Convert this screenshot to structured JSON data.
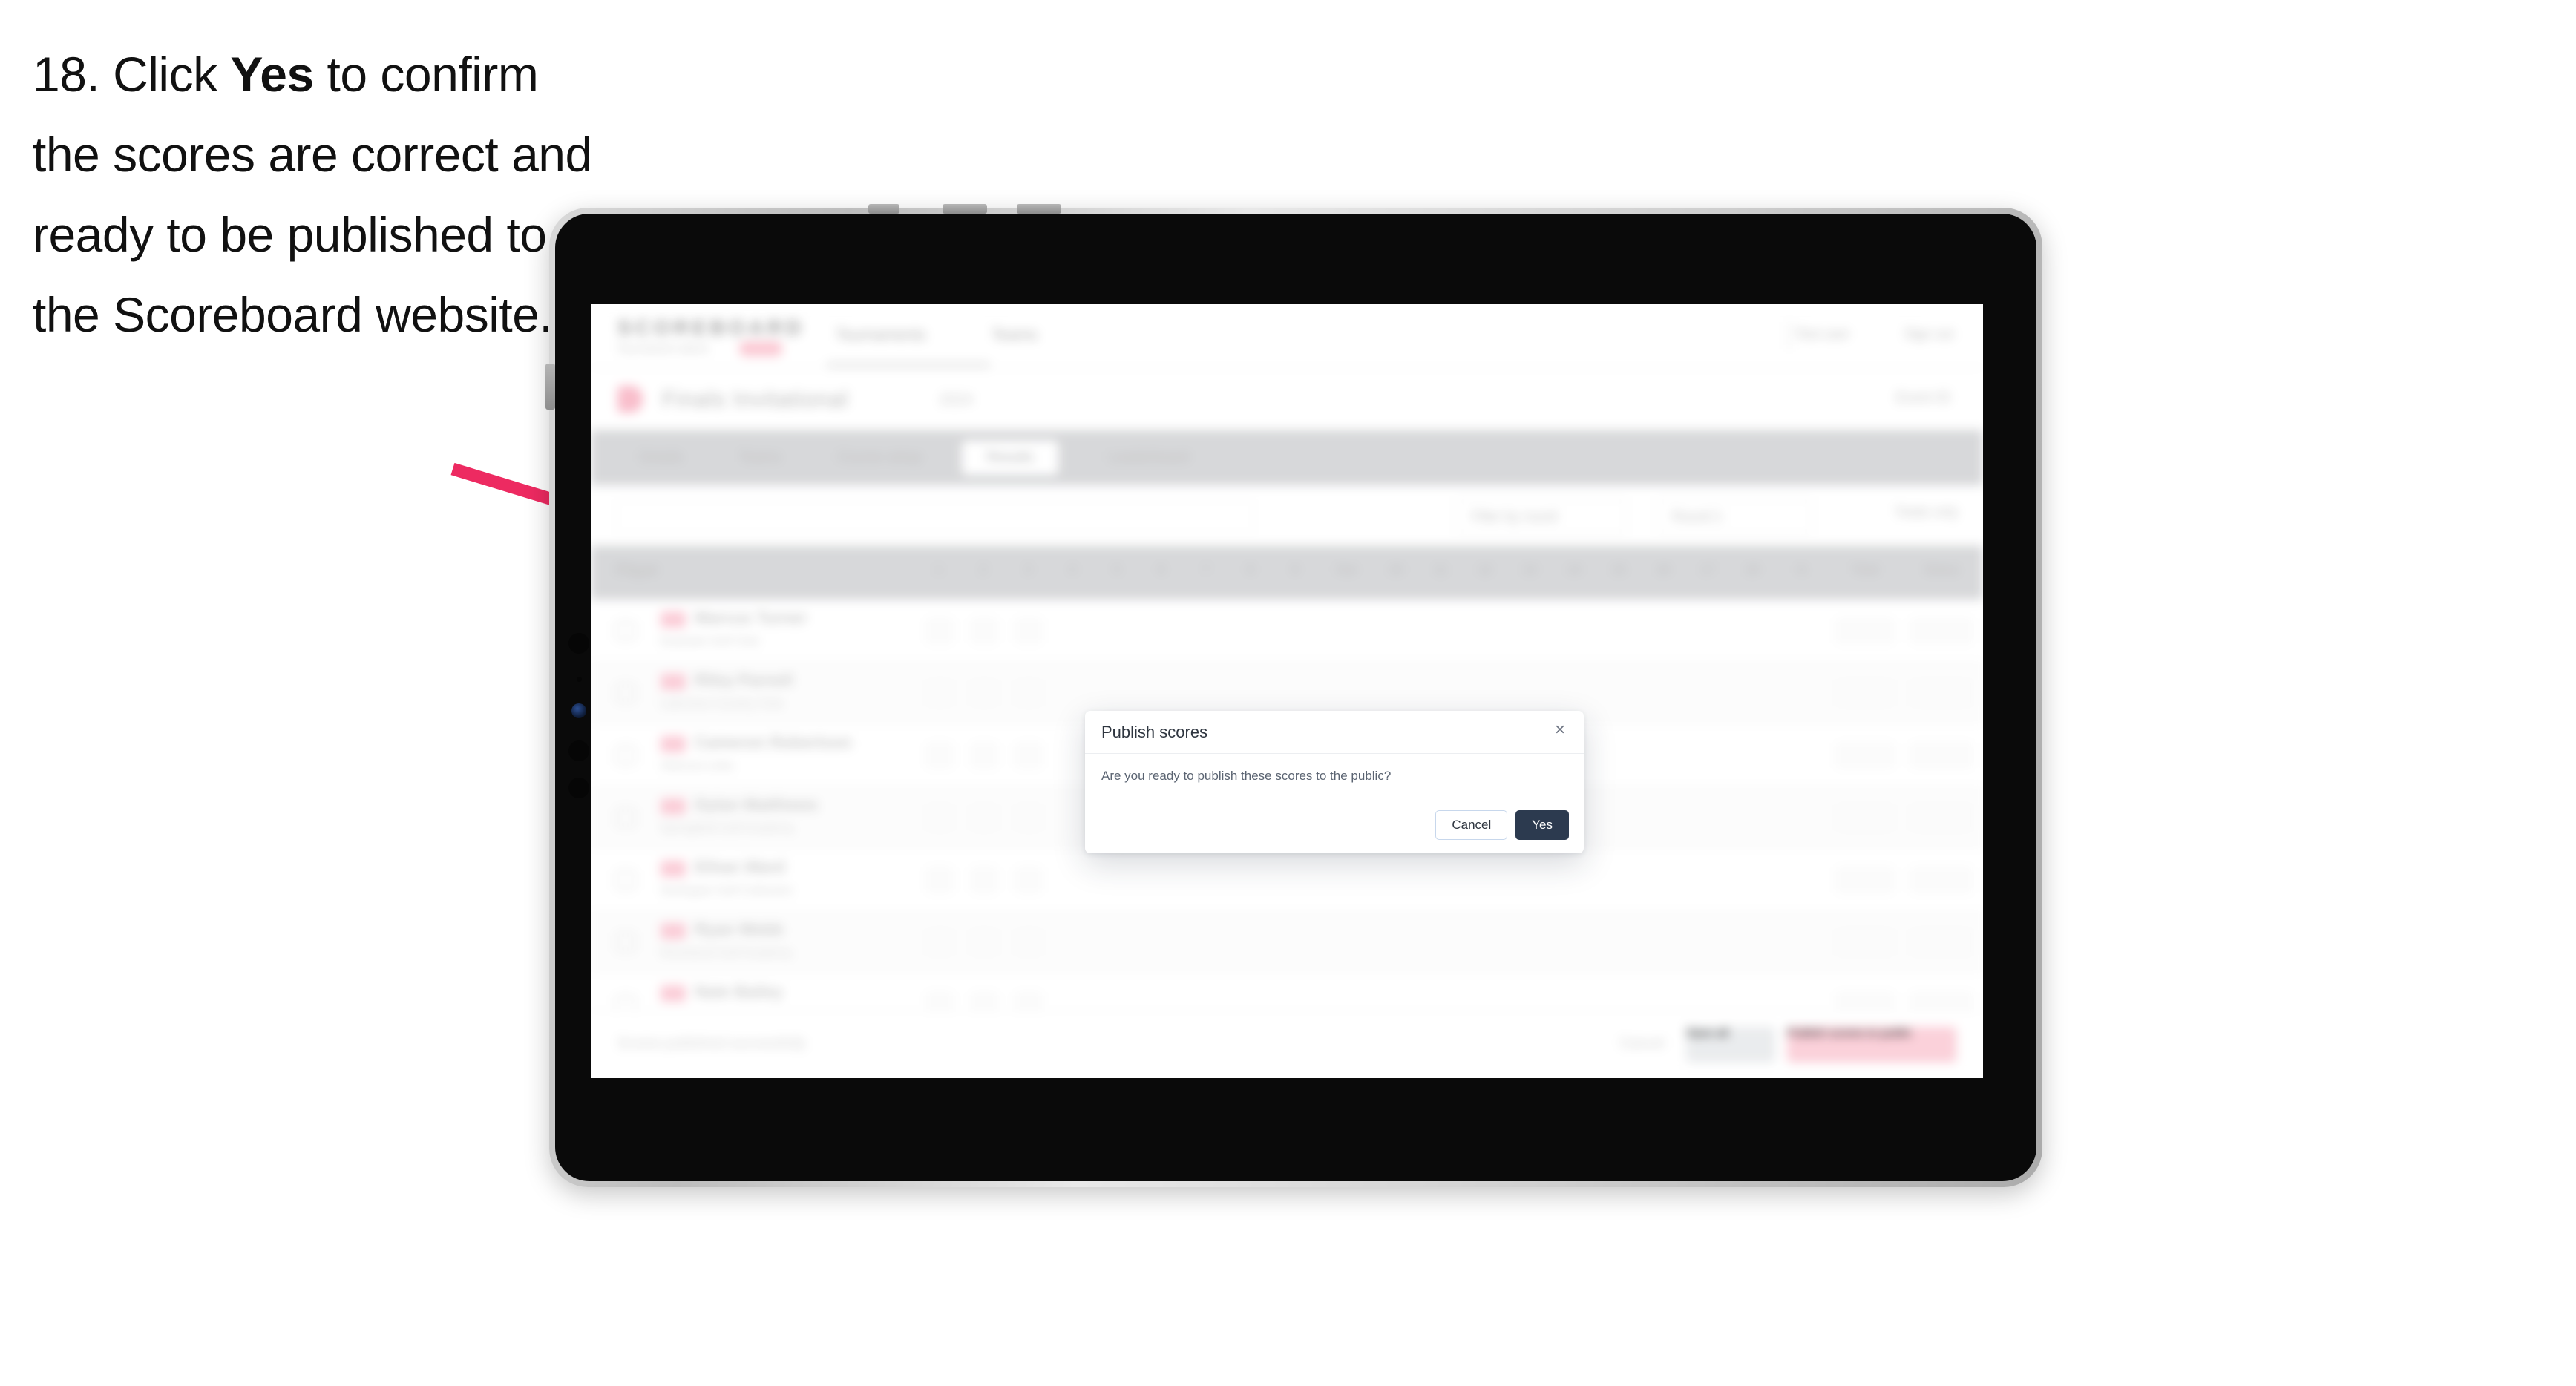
{
  "instruction": {
    "step_number": "18.",
    "part1": " Click ",
    "emphasis": "Yes",
    "part2": " to confirm the scores are correct and ready to be published to the Scoreboard website."
  },
  "colors": {
    "arrow": "#ED2A61",
    "yes_button_bg": "#2C3A4F",
    "cancel_border": "#C7D7EC",
    "brand_pink": "#F9B7C6"
  },
  "app": {
    "nav": {
      "logo": "SCOREBOARD",
      "logo_sub": "Tournament admin",
      "logo_badge": "BETA",
      "links": [
        "Tournaments",
        "Teams"
      ],
      "right_links": [
        "Test user",
        "Sign out"
      ]
    },
    "title_bar": {
      "event_title": "Finals Invitational",
      "event_pill": "2024",
      "right_action": "Event ID"
    },
    "tabs": [
      {
        "label": "Details",
        "selected": false
      },
      {
        "label": "Teams",
        "selected": false
      },
      {
        "label": "Course setup",
        "selected": false
      },
      {
        "label": "Results",
        "selected": true
      },
      {
        "label": "Leaderboard",
        "selected": false
      }
    ],
    "filters": {
      "search_placeholder": "Search",
      "dropdowns": [
        "Filter by round",
        "Round 1"
      ],
      "toggle_label": "Totals only"
    },
    "table": {
      "headers": [
        "Player",
        "1",
        "2",
        "3",
        "4",
        "5",
        "6",
        "7",
        "8",
        "9",
        "Out",
        "10",
        "11",
        "12",
        "13",
        "14",
        "15",
        "16",
        "17",
        "18",
        "In",
        "Total",
        "Status"
      ],
      "rows": [
        {
          "name": "Marcus Turner",
          "sub": "Eastside Golf Club"
        },
        {
          "name": "Riley Parnell",
          "sub": "Lakeview Country Club"
        },
        {
          "name": "Cameron Robertson",
          "sub": "Hillcrest Links"
        },
        {
          "name": "Dylan Matthews",
          "sub": "Springfield Golf Academy"
        },
        {
          "name": "Ethan Ward",
          "sub": "Northgate Golf Collective"
        },
        {
          "name": "Ryan Webb",
          "sub": "Riverbend Golf Academy"
        },
        {
          "name": "Nate Bailey",
          "sub": "Greenfield Golf Academy"
        }
      ]
    },
    "footer": {
      "note": "Scores published successfully",
      "link": "Cancel",
      "secondary_button": "Save all",
      "primary_button": "Publish scores to public"
    }
  },
  "modal": {
    "title": "Publish scores",
    "message": "Are you ready to publish these scores to the public?",
    "close_icon": "×",
    "cancel_label": "Cancel",
    "yes_label": "Yes"
  }
}
